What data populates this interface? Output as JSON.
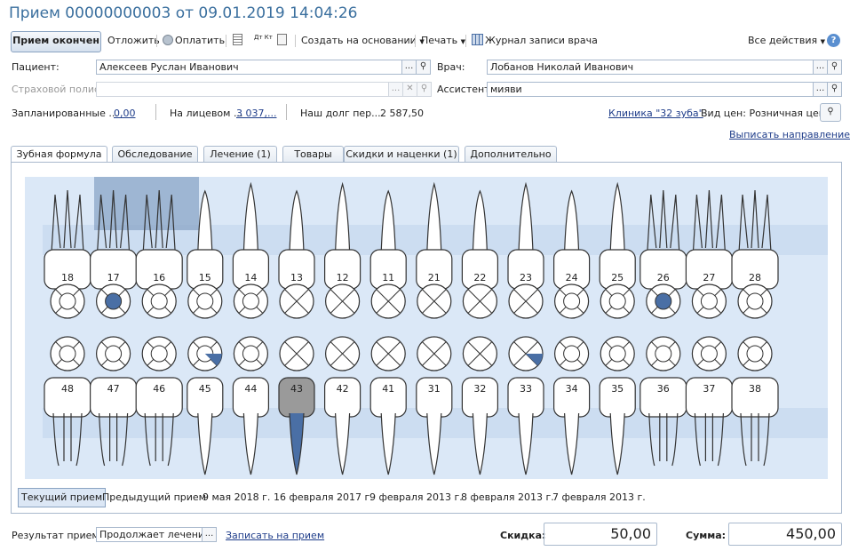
{
  "window": {
    "title": "Прием 00000000003 от 09.01.2019 14:04:26"
  },
  "toolbar": {
    "done": "Прием окончен",
    "postpone": "Отложить",
    "pay": "Оплатить",
    "create_based": "Создать на основании",
    "print": "Печать",
    "journal": "Журнал записи врача",
    "all_actions": "Все действия",
    "help": "?",
    "dtkt": "Дт Кт"
  },
  "form": {
    "patient_label": "Пациент:",
    "patient_value": "Алексеев Руслан Иванович",
    "doctor_label": "Врач:",
    "doctor_value": "Лобанов Николай Иванович",
    "insurance_label": "Страховой полис:",
    "insurance_value": "",
    "assistant_label": "Ассистент:",
    "assistant_value": "мияви",
    "planned_label": "Запланированные ...",
    "planned_value": "0,00",
    "account_label": "На лицевом ...",
    "account_value": "3 037,...",
    "debt_label": "Наш долг пер...",
    "debt_value": "2 587,50",
    "clinic_link": "Клиника \"32 зуба\"",
    "price_type": "Вид цен: Розничная цена",
    "referral_link": "Выписать направление"
  },
  "tabs": [
    "Зубная формула",
    "Обследование",
    "Лечение (1)",
    "Товары",
    "Скидки и наценки (1)",
    "Дополнительно"
  ],
  "teeth": {
    "upper": [
      "18",
      "17",
      "16",
      "15",
      "14",
      "13",
      "12",
      "11",
      "21",
      "22",
      "23",
      "24",
      "25",
      "26",
      "27",
      "28"
    ],
    "lower": [
      "48",
      "47",
      "46",
      "45",
      "44",
      "43",
      "42",
      "41",
      "31",
      "32",
      "33",
      "34",
      "35",
      "36",
      "37",
      "38"
    ]
  },
  "history": [
    "Текущий прием",
    "Предыдущий прием",
    "9 мая 2018 г.",
    "16 февраля 2017 г.",
    "9 февраля 2013 г.",
    "8 февраля 2013 г.",
    "7 февраля 2013 г."
  ],
  "bottom": {
    "result_label": "Результат приема:",
    "result_value": "Продолжает лечение",
    "appointment_link": "Записать на прием",
    "discount_label": "Скидка:",
    "discount_value": "50,00",
    "sum_label": "Сумма:",
    "sum_value": "450,00"
  },
  "colors": {
    "accent": "#3a6f9e",
    "tooth_fill": "#4a6fa5",
    "chart_bg": "#dbe8f7"
  }
}
